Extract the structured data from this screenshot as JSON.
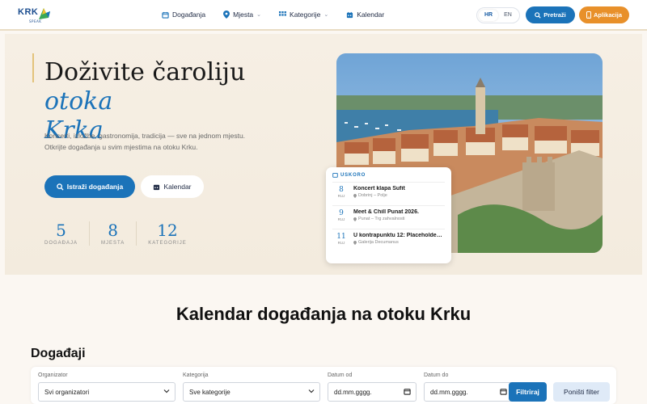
{
  "brand": {
    "logo_text": "KRK",
    "logo_sub": "SPEAK"
  },
  "nav": [
    {
      "label": "Događanja",
      "icon": "calendar-icon",
      "dropdown": false
    },
    {
      "label": "Mjesta",
      "icon": "map-pin-icon",
      "dropdown": true
    },
    {
      "label": "Kategorije",
      "icon": "grid-icon",
      "dropdown": true
    },
    {
      "label": "Kalendar",
      "icon": "calendar-icon",
      "dropdown": false
    }
  ],
  "lang": {
    "hr": "HR",
    "en": "EN",
    "active": "HR"
  },
  "header_buttons": {
    "search": "Pretraži",
    "app": "Aplikacija"
  },
  "hero": {
    "title_plain": "Doživite čaroliju ",
    "title_accent_1": "otoka",
    "title_accent_2": "Krka",
    "description": "Koncerti, izložbe, gastronomija, tradicija — sve na jednom mjestu. Otkrijte događanja u svim mjestima na otoku Krku.",
    "btn_explore": "Istraži događanja",
    "btn_calendar": "Kalendar",
    "stats": [
      {
        "num": "5",
        "label": "DOGAĐAJA"
      },
      {
        "num": "8",
        "label": "MJESTA"
      },
      {
        "num": "12",
        "label": "KATEGORIJE"
      }
    ]
  },
  "upcoming": {
    "heading": "USKORO",
    "items": [
      {
        "day": "8",
        "month": "RUJ",
        "title": "Koncert klapa Šufit",
        "location": "Dobrinj – Polje"
      },
      {
        "day": "9",
        "month": "RUJ",
        "title": "Meet & Chill Punat 2026.",
        "location": "Punat – Trg zahvalnosti"
      },
      {
        "day": "11",
        "month": "RUJ",
        "title": "U kontrapunktu 12: Placeholder...",
        "location": "Galerija Decumanus"
      }
    ]
  },
  "section_title": "Kalendar događanja na otoku Krku",
  "events_title": "Događaji",
  "filters": {
    "organizer_label": "Organizator",
    "organizer_value": "Svi organizatori",
    "category_label": "Kategorija",
    "category_value": "Sve kategorije",
    "date_from_label": "Datum od",
    "date_from_value": "dd.mm.gggg.",
    "date_to_label": "Datum do",
    "date_to_value": "dd.mm.gggg.",
    "filter_btn": "Filtriraj",
    "reset_btn": "Poništi filter"
  },
  "colors": {
    "primary": "#1b73b9",
    "accent": "#e8902a",
    "hero_bg": "#f6efe4"
  }
}
